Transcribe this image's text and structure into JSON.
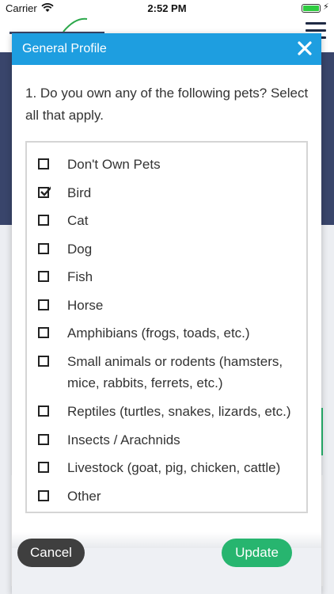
{
  "status_bar": {
    "carrier": "Carrier",
    "time": "2:52 PM"
  },
  "modal": {
    "title": "General Profile",
    "question": "1. Do you own any of the following pets? Select all that apply.",
    "options": [
      {
        "label": "Don't Own Pets",
        "checked": false
      },
      {
        "label": "Bird",
        "checked": true
      },
      {
        "label": "Cat",
        "checked": false
      },
      {
        "label": "Dog",
        "checked": false
      },
      {
        "label": "Fish",
        "checked": false
      },
      {
        "label": "Horse",
        "checked": false
      },
      {
        "label": "Amphibians (frogs, toads, etc.)",
        "checked": false
      },
      {
        "label": "Small animals or rodents (hamsters, mice, rabbits, ferrets, etc.)",
        "checked": false
      },
      {
        "label": "Reptiles (turtles, snakes, lizards, etc.)",
        "checked": false
      },
      {
        "label": "Insects / Arachnids",
        "checked": false
      },
      {
        "label": "Livestock (goat, pig, chicken, cattle)",
        "checked": false
      },
      {
        "label": "Other",
        "checked": false
      }
    ],
    "cancel_label": "Cancel",
    "update_label": "Update"
  },
  "colors": {
    "header_blue": "#1e9ee0",
    "navy_background": "#39456b",
    "update_green": "#27b56f",
    "cancel_dark": "#3f3f3f"
  },
  "icons": [
    "wifi-icon",
    "battery-icon",
    "close-icon",
    "hamburger-icon",
    "checkmark-icon"
  ]
}
